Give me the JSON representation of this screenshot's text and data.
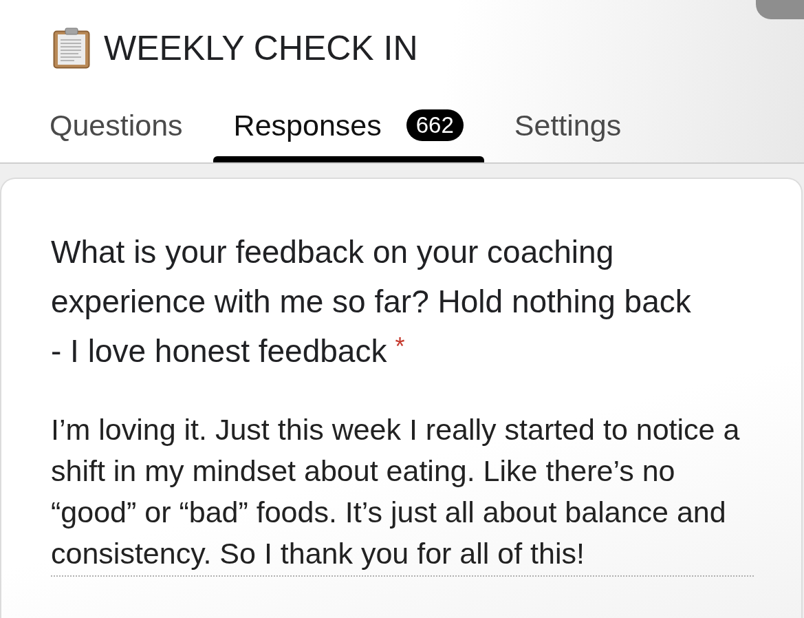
{
  "form": {
    "title": "WEEKLY CHECK IN"
  },
  "tabs": [
    {
      "label": "Questions",
      "selected": false
    },
    {
      "label": "Responses",
      "selected": true,
      "count": "662"
    },
    {
      "label": "Settings",
      "selected": false
    }
  ],
  "question": {
    "text": "What is your feedback on your coaching experience with me so far? Hold nothing back - I love honest feedback",
    "required_mark": "*"
  },
  "answer": {
    "value": "I’m loving it. Just this week I really started to notice a shift in my mindset about eating. Like there’s no “good” or “bad” foods. It’s just all about balance and consistency. So I thank you for all of this!"
  }
}
